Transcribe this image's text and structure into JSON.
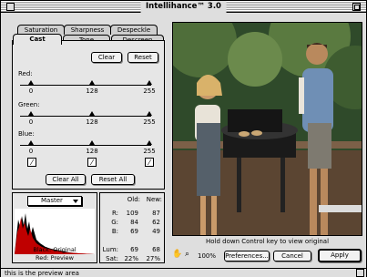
{
  "window": {
    "title": "Intellihance™ 3.0"
  },
  "tabs": {
    "row1": [
      "Saturation",
      "Sharpness",
      "Despeckle"
    ],
    "row2": [
      "Cast",
      "Tone",
      "Descreen"
    ],
    "active": "Cast"
  },
  "cast": {
    "clear_label": "Clear",
    "reset_label": "Reset",
    "channels": [
      {
        "label": "Red:",
        "ticks": [
          "0",
          "128",
          "255"
        ]
      },
      {
        "label": "Green:",
        "ticks": [
          "0",
          "128",
          "255"
        ]
      },
      {
        "label": "Blue:",
        "ticks": [
          "0",
          "128",
          "255"
        ]
      }
    ],
    "clear_all_label": "Clear All",
    "reset_all_label": "Reset All"
  },
  "histogram": {
    "channel_select": "Master",
    "caption_top": "Black: Original",
    "caption_bottom": "Red: Preview"
  },
  "values": {
    "old_header": "Old:",
    "new_header": "New:",
    "rows": [
      {
        "label": "R:",
        "old": "109",
        "new": "87"
      },
      {
        "label": "G:",
        "old": "84",
        "new": "62"
      },
      {
        "label": "B:",
        "old": "69",
        "new": "49"
      }
    ],
    "lum": {
      "label": "Lum:",
      "old": "69",
      "new": "68"
    },
    "sat": {
      "label": "Sat:",
      "old": "22%",
      "new": "27%"
    }
  },
  "preview": {
    "hint": "Hold down Control key to view original",
    "zoom": "100%"
  },
  "buttons": {
    "preferences": "Preferences...",
    "cancel": "Cancel",
    "apply": "Apply"
  },
  "status": {
    "text": "this is the preview area"
  }
}
